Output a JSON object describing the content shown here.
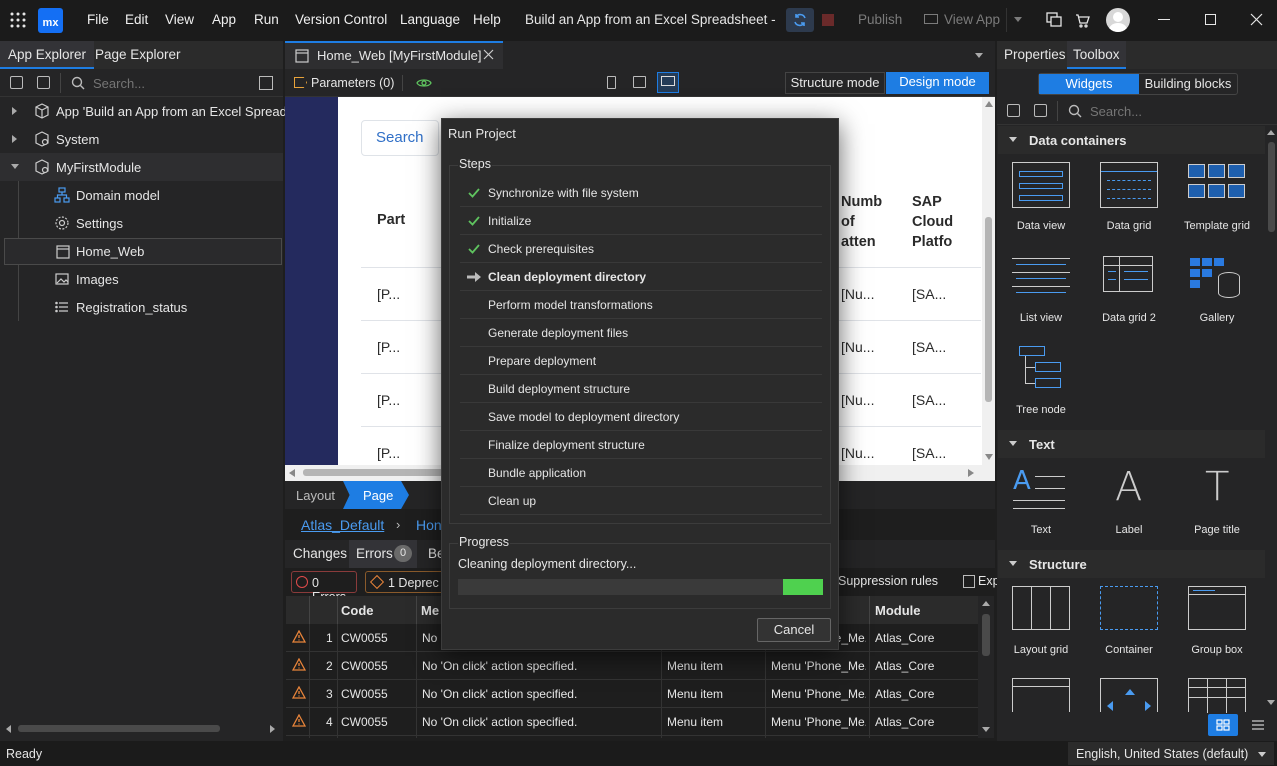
{
  "titlebar": {
    "logo": "mx",
    "menus": [
      "File",
      "Edit",
      "View",
      "App",
      "Run",
      "Version Control",
      "Language",
      "Help"
    ],
    "app_title": "Build an App from an Excel Spreadsheet  -",
    "publish": "Publish",
    "view_app": "View App"
  },
  "left_panel": {
    "tabs": [
      "App Explorer",
      "Page Explorer"
    ],
    "search_placeholder": "Search...",
    "tree": [
      {
        "label": "App 'Build an App from an Excel Spreads",
        "icon": "box-icon"
      },
      {
        "label": "System",
        "icon": "box-gear-icon"
      },
      {
        "label": "MyFirstModule",
        "icon": "box-gear-icon"
      },
      {
        "label": "Domain model",
        "icon": "domain-model-icon"
      },
      {
        "label": "Settings",
        "icon": "gear-icon"
      },
      {
        "label": "Home_Web",
        "icon": "page-icon"
      },
      {
        "label": "Images",
        "icon": "images-icon"
      },
      {
        "label": "Registration_status",
        "icon": "list-icon"
      }
    ]
  },
  "editor": {
    "tab_title": "Home_Web [MyFirstModule]",
    "parameters": "Parameters (0)",
    "structure_mode": "Structure mode",
    "design_mode": "Design mode",
    "canvas": {
      "search_button": "Search",
      "col_part": "Part",
      "col_num": [
        "Numb",
        "of",
        "atten"
      ],
      "col_sap": [
        "SAP",
        "Cloud",
        "Platfo"
      ],
      "cell_part": "[P...",
      "cell_num": "[Nu...",
      "cell_sap": "[SA..."
    },
    "crumb_layout": "Layout",
    "crumb_page": "Page",
    "breadcrumb_link": "Atlas_Default",
    "breadcrumb_next": "Hon"
  },
  "bottom_panel": {
    "tabs": [
      "Changes",
      "Errors",
      "Be"
    ],
    "errors_count": "0",
    "errors_filter": "0 Errors",
    "deprec_filter": "1 Deprec",
    "suppression": "Suppression rules",
    "export": "Exp",
    "headers": {
      "code": "Code",
      "message": "Me",
      "module": "Module"
    },
    "rows": [
      {
        "num": "1",
        "code": "CW0055",
        "message": "No",
        "element": "",
        "document": "Menu 'Phone_Me...",
        "module": "Atlas_Core"
      },
      {
        "num": "2",
        "code": "CW0055",
        "message": "No 'On click' action specified.",
        "element": "Menu item",
        "document": "Menu 'Phone_Me...",
        "module": "Atlas_Core"
      },
      {
        "num": "3",
        "code": "CW0055",
        "message": "No 'On click' action specified.",
        "element": "Menu item",
        "document": "Menu 'Phone_Me...",
        "module": "Atlas_Core"
      },
      {
        "num": "4",
        "code": "CW0055",
        "message": "No 'On click' action specified.",
        "element": "Menu item",
        "document": "Menu 'Phone_Me...",
        "module": "Atlas_Core"
      }
    ]
  },
  "dialog": {
    "title": "Run Project",
    "steps_label": "Steps",
    "steps": [
      {
        "label": "Synchronize with file system",
        "state": "done"
      },
      {
        "label": "Initialize",
        "state": "done"
      },
      {
        "label": "Check prerequisites",
        "state": "done"
      },
      {
        "label": "Clean deployment directory",
        "state": "current"
      },
      {
        "label": "Perform model transformations",
        "state": "pending"
      },
      {
        "label": "Generate deployment files",
        "state": "pending"
      },
      {
        "label": "Prepare deployment",
        "state": "pending"
      },
      {
        "label": "Build deployment structure",
        "state": "pending"
      },
      {
        "label": "Save model to deployment directory",
        "state": "pending"
      },
      {
        "label": "Finalize deployment structure",
        "state": "pending"
      },
      {
        "label": "Bundle application",
        "state": "pending"
      },
      {
        "label": "Clean up",
        "state": "pending"
      }
    ],
    "progress_label": "Progress",
    "progress_status": "Cleaning deployment directory...",
    "progress_fraction": 0.11,
    "cancel": "Cancel"
  },
  "right_panel": {
    "tabs": [
      "Properties",
      "Toolbox"
    ],
    "segments": [
      "Widgets",
      "Building blocks"
    ],
    "search_placeholder": "Search...",
    "sections": [
      {
        "name": "Data containers",
        "items": [
          "Data view",
          "Data grid",
          "Template grid",
          "List view",
          "Data grid 2",
          "Gallery",
          "Tree node"
        ]
      },
      {
        "name": "Text",
        "items": [
          "Text",
          "Label",
          "Page title"
        ]
      },
      {
        "name": "Structure",
        "items": [
          "Layout grid",
          "Container",
          "Group box"
        ]
      }
    ]
  },
  "statusbar": {
    "status": "Ready",
    "language": "English, United States (default)"
  },
  "colors": {
    "accent": "#1e7de3",
    "logo_bg": "#146ff4",
    "progress_green": "#4fd14f",
    "check_green": "#5fc35f",
    "warning": "#e8843a",
    "error": "#e04b4b"
  }
}
